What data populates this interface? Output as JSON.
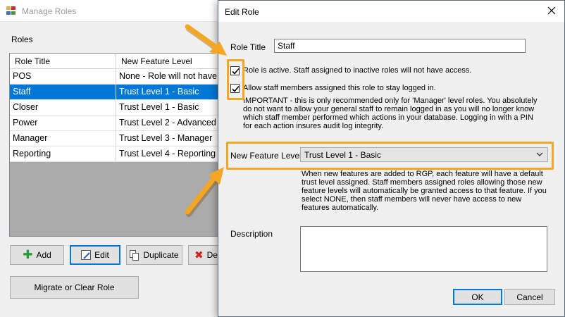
{
  "manage_roles": {
    "title": "Manage Roles",
    "roles_label": "Roles",
    "columns": [
      "Role Title",
      "New Feature Level"
    ],
    "rows": [
      {
        "role": "POS",
        "level": "None - Role will not have a"
      },
      {
        "role": "Staff",
        "level": "Trust Level 1 - Basic"
      },
      {
        "role": "Closer",
        "level": "Trust Level 1 - Basic"
      },
      {
        "role": "Power",
        "level": "Trust Level 2 - Advanced"
      },
      {
        "role": "Manager",
        "level": "Trust Level 3 - Manager"
      },
      {
        "role": "Reporting",
        "level": "Trust Level 4 - Reporting"
      }
    ],
    "selected_row": 1,
    "buttons": {
      "add": "Add",
      "edit": "Edit",
      "duplicate": "Duplicate",
      "delete": "Del",
      "migrate": "Migrate or Clear Role"
    }
  },
  "edit_role": {
    "title": "Edit Role",
    "role_title_label": "Role Title",
    "role_title_value": "Staff",
    "active_checkbox": {
      "checked": true,
      "label": "Role is active.  Staff assigned to inactive roles will not have access."
    },
    "stay_logged_in_checkbox": {
      "checked": true,
      "label": "Allow staff members assigned this role to stay logged in.",
      "note": "IMPORTANT - this is only recommended only for 'Manager' level roles.  You absolutely do not want to allow your general staff to remain logged in as you will no longer know which staff member performed which actions in your database.  Logging in with a PIN for each action insures audit log integrity."
    },
    "new_feature_level_label": "New Feature Level",
    "new_feature_level_value": "Trust Level 1 - Basic",
    "new_feature_note": "When new features are added to RGP, each feature will have a default trust level assigned.  Staff members assigned roles allowing those new feature levels will automatically be granted access to that feature.  If you select NONE, then staff members will never have access to new features automatically.",
    "description_label": "Description",
    "description_value": "",
    "ok_label": "OK",
    "cancel_label": "Cancel"
  },
  "colors": {
    "highlight": "#f5a623",
    "selection": "#0078d7"
  }
}
